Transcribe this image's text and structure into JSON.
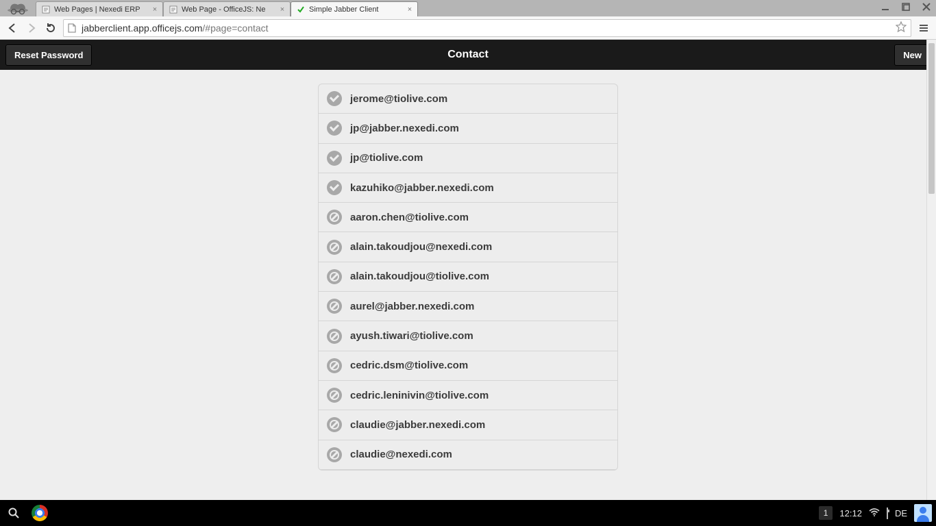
{
  "browser": {
    "tabs": [
      {
        "title": "Web Pages | Nexedi ERP",
        "active": false,
        "favicon": "doc"
      },
      {
        "title": "Web Page - OfficeJS: Ne",
        "active": false,
        "favicon": "doc"
      },
      {
        "title": "Simple Jabber Client",
        "active": true,
        "favicon": "check"
      }
    ],
    "url_host": "jabberclient.app.officejs.com",
    "url_path": "/#page=contact"
  },
  "app": {
    "header": {
      "left_button": "Reset Password",
      "title": "Contact",
      "right_button": "New"
    },
    "contacts": [
      {
        "jid": "jerome@tiolive.com",
        "status": "online"
      },
      {
        "jid": "jp@jabber.nexedi.com",
        "status": "online"
      },
      {
        "jid": "jp@tiolive.com",
        "status": "online"
      },
      {
        "jid": "kazuhiko@jabber.nexedi.com",
        "status": "online"
      },
      {
        "jid": "aaron.chen@tiolive.com",
        "status": "offline"
      },
      {
        "jid": "alain.takoudjou@nexedi.com",
        "status": "offline"
      },
      {
        "jid": "alain.takoudjou@tiolive.com",
        "status": "offline"
      },
      {
        "jid": "aurel@jabber.nexedi.com",
        "status": "offline"
      },
      {
        "jid": "ayush.tiwari@tiolive.com",
        "status": "offline"
      },
      {
        "jid": "cedric.dsm@tiolive.com",
        "status": "offline"
      },
      {
        "jid": "cedric.leninivin@tiolive.com",
        "status": "offline"
      },
      {
        "jid": "claudie@jabber.nexedi.com",
        "status": "offline"
      },
      {
        "jid": "claudie@nexedi.com",
        "status": "offline"
      }
    ]
  },
  "taskbar": {
    "notification_count": "1",
    "clock": "12:12",
    "keyboard_layout": "DE"
  }
}
